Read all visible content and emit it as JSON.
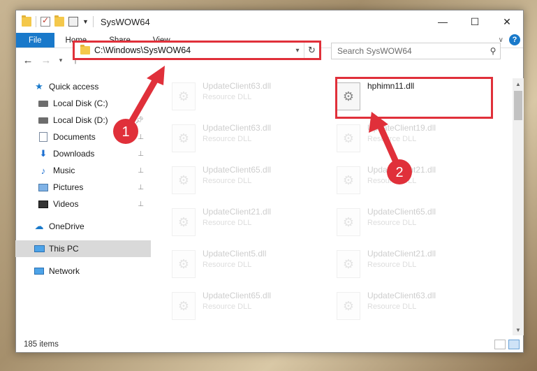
{
  "window": {
    "title": "SysWOW64"
  },
  "window_controls": {
    "minimize": "—",
    "maximize": "☐",
    "close": "✕"
  },
  "ribbon": {
    "tabs": [
      {
        "label": "File"
      },
      {
        "label": "Home"
      },
      {
        "label": "Share"
      },
      {
        "label": "View"
      }
    ],
    "help": "?"
  },
  "address_bar": {
    "path": "C:\\Windows\\SysWOW64"
  },
  "search": {
    "placeholder": "Search SysWOW64"
  },
  "sidebar": {
    "items": [
      {
        "label": "Quick access",
        "icon": "star-icon"
      },
      {
        "label": "Local Disk (C:)",
        "icon": "disk-icon"
      },
      {
        "label": "Local Disk (D:)",
        "icon": "disk-icon"
      },
      {
        "label": "Documents",
        "icon": "documents-icon"
      },
      {
        "label": "Downloads",
        "icon": "downloads-icon"
      },
      {
        "label": "Music",
        "icon": "music-icon"
      },
      {
        "label": "Pictures",
        "icon": "pictures-icon"
      },
      {
        "label": "Videos",
        "icon": "videos-icon"
      },
      {
        "label": "OneDrive",
        "icon": "cloud-icon"
      },
      {
        "label": "This PC",
        "icon": "pc-icon"
      },
      {
        "label": "Network",
        "icon": "network-icon"
      }
    ]
  },
  "files": [
    {
      "name": "UpdateClient63.dll",
      "type": "Resource DLL"
    },
    {
      "name": "hphimn11.dll",
      "type": ""
    },
    {
      "name": "UpdateClient63.dll",
      "type": "Resource DLL"
    },
    {
      "name": "UpdateClient19.dll",
      "type": "Resource DLL"
    },
    {
      "name": "UpdateClient65.dll",
      "type": "Resource DLL"
    },
    {
      "name": "UpdateClient21.dll",
      "type": "Resource DLL"
    },
    {
      "name": "UpdateClient21.dll",
      "type": "Resource DLL"
    },
    {
      "name": "UpdateClient65.dll",
      "type": "Resource DLL"
    },
    {
      "name": "UpdateClient5.dll",
      "type": "Resource DLL"
    },
    {
      "name": "UpdateClient21.dll",
      "type": "Resource DLL"
    },
    {
      "name": "UpdateClient65.dll",
      "type": "Resource DLL"
    },
    {
      "name": "UpdateClient63.dll",
      "type": "Resource DLL"
    }
  ],
  "status": {
    "item_count": "185 items"
  },
  "annotations": {
    "step1": "1",
    "step2": "2"
  },
  "colors": {
    "accent": "#1979ca",
    "highlight": "#e0303a"
  }
}
